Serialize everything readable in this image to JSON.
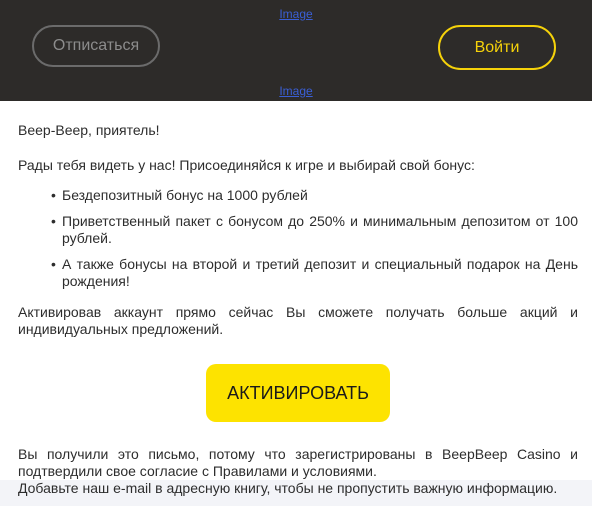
{
  "header": {
    "image_top": "Image",
    "image_bottom": "Image",
    "unsubscribe_label": "Отписаться",
    "login_label": "Войти"
  },
  "body": {
    "greeting": "Beep-Beep, приятель!",
    "intro": "Рады тебя видеть у нас! Присоединяйся к игре и выбирай свой бонус:",
    "bonuses": [
      "Бездепозитный бонус на 1000 рублей",
      "Приветственный пакет с бонусом до 250% и минимальным депозитом от 100 рублей.",
      "А также бонусы на второй и третий депозит и специальный подарок на День рождения!"
    ],
    "bullet": "•",
    "activate_text": "Активировав аккаунт прямо сейчас Вы сможете получать больше акций и индивидуальных предложений.",
    "cta_label": "АКТИВИРОВАТЬ",
    "footer_text": "Вы получили это письмо, потому что зарегистрированы в BeepBeep Casino и подтвердили свое согласие с Правилами и условиями.",
    "footer_address_book": "Добавьте наш e-mail в адресную книгу, чтобы не пропустить важную информацию."
  },
  "colors": {
    "header_bg": "#2d2b29",
    "accent_yellow": "#fde300",
    "link_blue": "#3a5fd6"
  }
}
